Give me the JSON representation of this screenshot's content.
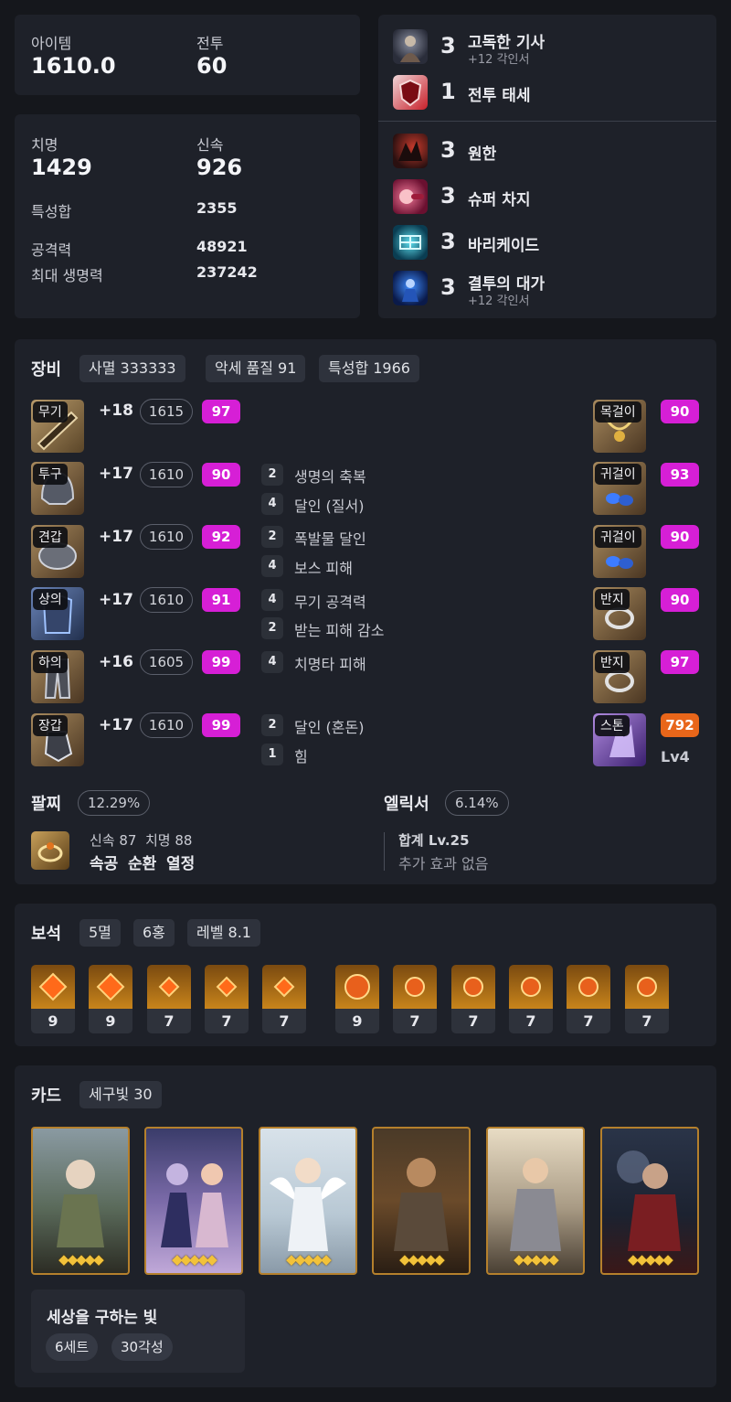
{
  "summary": {
    "item_label": "아이템",
    "item_value": "1610.0",
    "combat_label": "전투",
    "combat_value": "60"
  },
  "stats": {
    "crit_label": "치명",
    "crit_value": "1429",
    "swift_label": "신속",
    "swift_value": "926",
    "total_label": "특성합",
    "total_value": "2355",
    "attack_label": "공격력",
    "attack_value": "48921",
    "hp_label": "최대 생명력",
    "hp_value": "237242"
  },
  "engravings_top": [
    {
      "level": "3",
      "name": "고독한 기사",
      "sub": "+12 각인서",
      "icon": "lone-knight-icon"
    },
    {
      "level": "1",
      "name": "전투 태세",
      "sub": "",
      "icon": "battle-stance-icon"
    }
  ],
  "engravings_bottom": [
    {
      "level": "3",
      "name": "원한",
      "sub": "",
      "icon": "grudge-icon"
    },
    {
      "level": "3",
      "name": "슈퍼 차지",
      "sub": "",
      "icon": "super-charge-icon"
    },
    {
      "level": "3",
      "name": "바리케이드",
      "sub": "",
      "icon": "barricade-icon"
    },
    {
      "level": "3",
      "name": "결투의 대가",
      "sub": "+12 각인서",
      "icon": "master-brawler-icon"
    }
  ],
  "equipment": {
    "title": "장비",
    "chips": [
      "사멸 333333",
      "악세 품질 91",
      "특성합 1966"
    ],
    "gear": [
      {
        "tag": "무기",
        "refine": "+18",
        "ilvl": "1615",
        "quality": "97",
        "sets": []
      },
      {
        "tag": "투구",
        "refine": "+17",
        "ilvl": "1610",
        "quality": "90",
        "sets": [
          {
            "n": "2",
            "name": "생명의 축복"
          },
          {
            "n": "4",
            "name": "달인 (질서)"
          }
        ]
      },
      {
        "tag": "견갑",
        "refine": "+17",
        "ilvl": "1610",
        "quality": "92",
        "sets": [
          {
            "n": "2",
            "name": "폭발물 달인"
          },
          {
            "n": "4",
            "name": "보스 피해"
          }
        ]
      },
      {
        "tag": "상의",
        "refine": "+17",
        "ilvl": "1610",
        "quality": "91",
        "sets": [
          {
            "n": "4",
            "name": "무기 공격력"
          },
          {
            "n": "2",
            "name": "받는 피해 감소"
          }
        ]
      },
      {
        "tag": "하의",
        "refine": "+16",
        "ilvl": "1605",
        "quality": "99",
        "sets": [
          {
            "n": "4",
            "name": "치명타 피해"
          }
        ]
      },
      {
        "tag": "장갑",
        "refine": "+17",
        "ilvl": "1610",
        "quality": "99",
        "sets": [
          {
            "n": "2",
            "name": "달인 (혼돈)"
          },
          {
            "n": "1",
            "name": "힘"
          }
        ]
      }
    ],
    "accessories": [
      {
        "tag": "목걸이",
        "quality": "90"
      },
      {
        "tag": "귀걸이",
        "quality": "93"
      },
      {
        "tag": "귀걸이",
        "quality": "90"
      },
      {
        "tag": "반지",
        "quality": "90"
      },
      {
        "tag": "반지",
        "quality": "97"
      },
      {
        "tag": "스톤",
        "quality": "792",
        "level": "Lv4"
      }
    ],
    "bracelet_label": "팔찌",
    "bracelet_chip": "12.29%",
    "bracelet_stats": "신속 87  치명 88",
    "bracelet_effects": [
      "속공",
      "순환",
      "열정"
    ],
    "elixir_label": "엘릭서",
    "elixir_chip": "6.14%",
    "elixir_total": "합계 Lv.25",
    "elixir_extra": "추가 효과 없음"
  },
  "gems": {
    "title": "보석",
    "chips": [
      "5멸",
      "6홍",
      "레벨 8.1"
    ],
    "doom_levels": [
      "9",
      "9",
      "7",
      "7",
      "7"
    ],
    "crimson_levels": [
      "9",
      "7",
      "7",
      "7",
      "7",
      "7"
    ]
  },
  "cards": {
    "title": "카드",
    "chip": "세구빛 30",
    "awakening": [
      "◆◆◆◆◆",
      "◆◆◆◆◆",
      "◆◆◆◆◆",
      "◆◆◆◆◆",
      "◆◆◆◆◆",
      "◆◆◆◆◆"
    ],
    "set_name": "세상을 구하는 빛",
    "set_chips": [
      "6세트",
      "30각성"
    ]
  }
}
